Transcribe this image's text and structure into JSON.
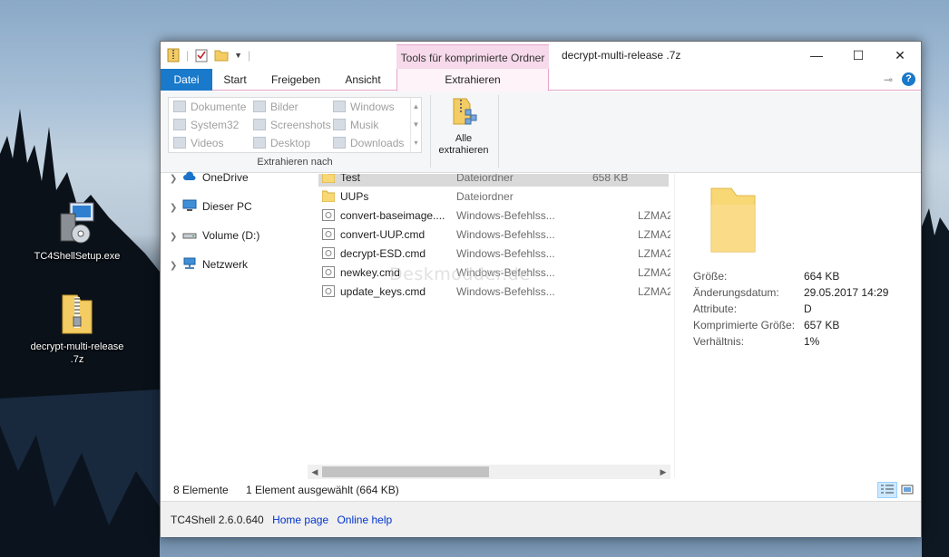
{
  "desktop": {
    "icons": [
      {
        "label": "TC4ShellSetup.exe",
        "icon": "installer-icon"
      },
      {
        "label": "decrypt-multi-release\n.7z",
        "icon": "zip-folder-icon"
      }
    ]
  },
  "window": {
    "title": "decrypt-multi-release .7z",
    "context_tab_header": "Tools für komprimierte Ordner",
    "controls": {
      "minimize": "—",
      "maximize": "☐",
      "close": "✕"
    }
  },
  "ribbon_tabs": {
    "file": "Datei",
    "start": "Start",
    "share": "Freigeben",
    "view": "Ansicht",
    "extract": "Extrahieren"
  },
  "ribbon": {
    "gallery": [
      {
        "label": "Dokumente",
        "icon": "documents-icon"
      },
      {
        "label": "Bilder",
        "icon": "pictures-icon"
      },
      {
        "label": "Windows",
        "icon": "windows-folder-icon"
      },
      {
        "label": "System32",
        "icon": "system-folder-icon"
      },
      {
        "label": "Screenshots",
        "icon": "screenshots-icon"
      },
      {
        "label": "Musik",
        "icon": "music-icon"
      },
      {
        "label": "Videos",
        "icon": "videos-icon"
      },
      {
        "label": "Desktop",
        "icon": "desktop-icon"
      },
      {
        "label": "Downloads",
        "icon": "downloads-icon"
      }
    ],
    "group_label": "Extrahieren nach",
    "extract_all_line1": "Alle",
    "extract_all_line2": "extrahieren"
  },
  "nav": [
    {
      "label": "OneDrive",
      "icon": "cloud-icon"
    },
    {
      "label": "Dieser PC",
      "icon": "computer-icon"
    },
    {
      "label": "Volume (D:)",
      "icon": "drive-icon"
    },
    {
      "label": "Netzwerk",
      "icon": "network-icon"
    }
  ],
  "files": [
    {
      "name": "Test",
      "type": "Dateiordner",
      "size": "658 KB",
      "method": "",
      "icon": "folder-icon",
      "selected": true
    },
    {
      "name": "UUPs",
      "type": "Dateiordner",
      "size": "",
      "method": "",
      "icon": "folder-icon",
      "selected": false
    },
    {
      "name": "convert-baseimage....",
      "type": "Windows-Befehlss...",
      "size": "",
      "method": "LZMA2",
      "icon": "script-icon",
      "selected": false
    },
    {
      "name": "convert-UUP.cmd",
      "type": "Windows-Befehlss...",
      "size": "",
      "method": "LZMA2",
      "icon": "script-icon",
      "selected": false
    },
    {
      "name": "decrypt-ESD.cmd",
      "type": "Windows-Befehlss...",
      "size": "",
      "method": "LZMA2",
      "icon": "script-icon",
      "selected": false
    },
    {
      "name": "newkey.cmd",
      "type": "Windows-Befehlss...",
      "size": "",
      "method": "LZMA2",
      "icon": "script-icon",
      "selected": false
    },
    {
      "name": "update_keys.cmd",
      "type": "Windows-Befehlss...",
      "size": "",
      "method": "LZMA2",
      "icon": "script-icon",
      "selected": false
    }
  ],
  "details": {
    "properties": [
      {
        "key": "Größe:",
        "value": "664 KB"
      },
      {
        "key": "Änderungsdatum:",
        "value": "29.05.2017 14:29"
      },
      {
        "key": "Attribute:",
        "value": "D"
      },
      {
        "key": "Komprimierte Größe:",
        "value": "657 KB"
      },
      {
        "key": "Verhältnis:",
        "value": "1%"
      }
    ]
  },
  "status": {
    "count": "8 Elemente",
    "selection": "1 Element ausgewählt (664 KB)"
  },
  "footer": {
    "version": "TC4Shell 2.6.0.640",
    "home_link": "Home page",
    "help_link": "Online help"
  },
  "watermark": "Deskmodder.de",
  "colors": {
    "accent": "#1979ca",
    "context_tab": "#f6d9ea",
    "folder": "#f8d775"
  }
}
